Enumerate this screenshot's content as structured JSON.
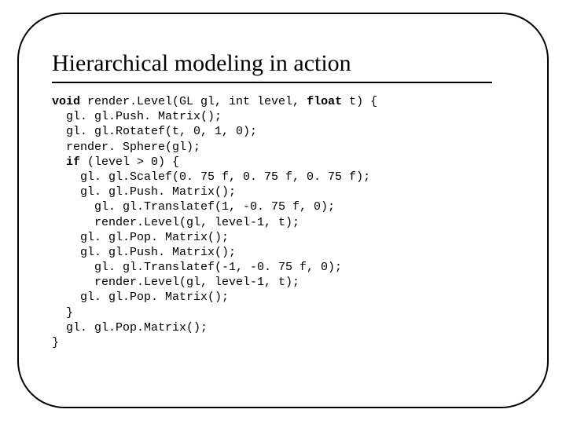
{
  "title": "Hierarchical modeling in action",
  "code": {
    "kw_void": "void",
    "fn_sig_a": " render.Level(GL gl, int level, ",
    "kw_float": "float",
    "fn_sig_b": " t) {",
    "l2": "  gl. gl.Push. Matrix();",
    "l3": "  gl. gl.Rotatef(t, 0, 1, 0);",
    "l4": "  render. Sphere(gl);",
    "l5a": "  ",
    "kw_if": "if",
    "l5b": " (level > 0) {",
    "l6": "    gl. gl.Scalef(0. 75 f, 0. 75 f, 0. 75 f);",
    "l7": "    gl. gl.Push. Matrix();",
    "l8": "      gl. gl.Translatef(1, -0. 75 f, 0);",
    "l9": "      render.Level(gl, level-1, t);",
    "l10": "    gl. gl.Pop. Matrix();",
    "l11": "    gl. gl.Push. Matrix();",
    "l12": "      gl. gl.Translatef(-1, -0. 75 f, 0);",
    "l13": "      render.Level(gl, level-1, t);",
    "l14": "    gl. gl.Pop. Matrix();",
    "l15": "  }",
    "l16": "  gl. gl.Pop.Matrix();",
    "l17": "}"
  }
}
